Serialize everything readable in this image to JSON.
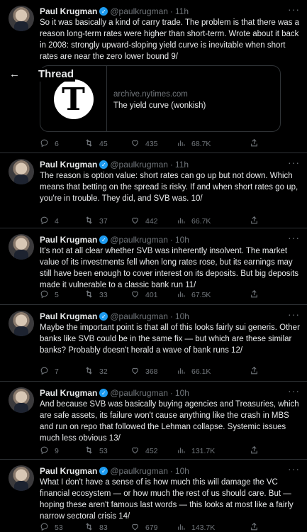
{
  "author": {
    "name": "Paul Krugman",
    "handle": "@paulkrugman",
    "dot": "·"
  },
  "topbar": {
    "title": "Thread",
    "back_arrow": "←"
  },
  "card": {
    "domain": "archive.nytimes.com",
    "title": "The yield curve (wonkish)",
    "logo_glyph": "T"
  },
  "tweets": [
    {
      "time": "11h",
      "text": "So it was basically a kind of carry trade. The problem is that there was a reason long-term rates were higher than short-term. Wrote about it back in 2008: strongly upward-sloping yield curve is inevitable when short rates are near the zero lower bound 9/",
      "replies": "6",
      "retweets": "45",
      "likes": "435",
      "views": "68.7K"
    },
    {
      "time": "11h",
      "text": "The reason is option value: short rates can go up but not down. Which means that betting on the spread is risky. If and when short rates go up, you're in trouble. They did, and SVB was. 10/",
      "replies": "4",
      "retweets": "37",
      "likes": "442",
      "views": "66.7K"
    },
    {
      "time": "10h",
      "text": "It's not at all clear whether SVB was inherently insolvent. The market value of its investments fell when long rates rose, but its earnings may still have been enough to cover interest on its deposits. But big deposits made it vulnerable to a classic bank run 11/",
      "replies": "5",
      "retweets": "33",
      "likes": "401",
      "views": "67.5K"
    },
    {
      "time": "10h",
      "text": "Maybe the important point is that all of this looks fairly sui generis. Other banks like SVB could be in the same fix — but which are these similar banks? Probably doesn't herald a wave of bank runs 12/",
      "replies": "7",
      "retweets": "32",
      "likes": "368",
      "views": "66.1K"
    },
    {
      "time": "10h",
      "text": "And because SVB was basically buying agencies and Treasuries, which are safe assets, its failure won't cause anything like the crash in MBS and run on repo that followed the Lehman collapse. Systemic issues much less obvious 13/",
      "replies": "9",
      "retweets": "53",
      "likes": "452",
      "views": "131.7K"
    },
    {
      "time": "10h",
      "text": "What I don't have a sense of is how much this will damage the VC financial ecosystem — or how much the rest of us should care. But — hoping these aren't famous last words — this looks at most like a fairly narrow sectoral crisis 14/",
      "replies": "53",
      "retweets": "83",
      "likes": "679",
      "views": "143.7K"
    }
  ],
  "icons": {
    "reply": "reply-icon",
    "retweet": "retweet-icon",
    "like": "heart-icon",
    "views": "views-icon",
    "share": "share-icon",
    "more": "more-icon",
    "verified": "verified-badge-icon"
  }
}
